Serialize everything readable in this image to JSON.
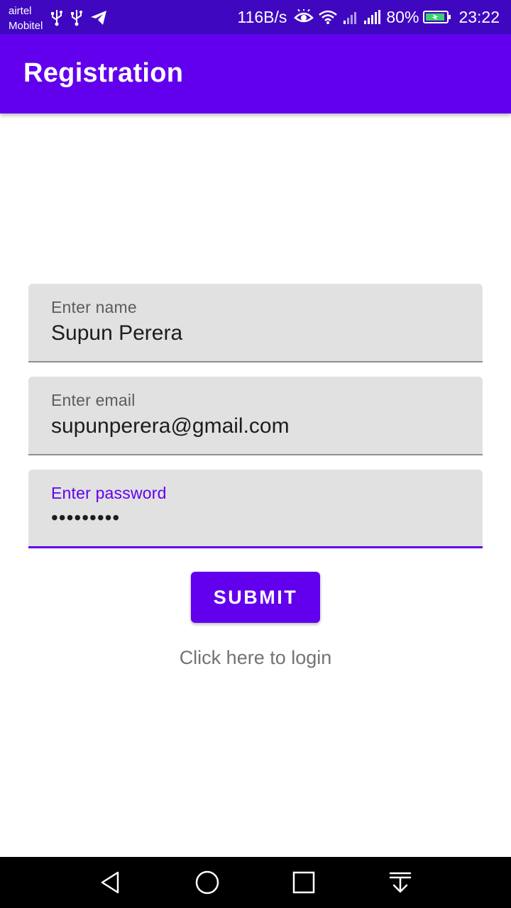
{
  "status_bar": {
    "carrier_1": "airtel",
    "carrier_2": "Mobitel",
    "net_speed": "116B/s",
    "battery": "80%",
    "time": "23:22",
    "background": "#3f08c0"
  },
  "app_bar": {
    "title": "Registration",
    "background": "#6200ee"
  },
  "form": {
    "name": {
      "label": "Enter name",
      "value": "Supun Perera"
    },
    "email": {
      "label": "Enter email",
      "value": "supunperera@gmail.com"
    },
    "password": {
      "label": "Enter password",
      "value": "•••••••••",
      "focused": true
    },
    "submit_label": "SUBMIT",
    "login_link": "Click here to login"
  },
  "nav_bar": {
    "icons": [
      "back-icon",
      "home-icon",
      "recents-icon",
      "notification-pull-icon"
    ]
  },
  "colors": {
    "primary": "#6200ee",
    "field_bg": "#e1e1e1"
  }
}
